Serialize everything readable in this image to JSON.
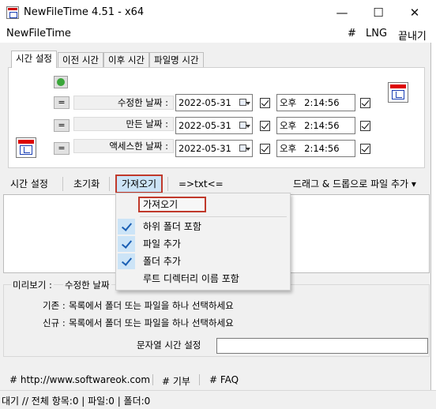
{
  "window": {
    "title": "NewFileTime 4.51 - x64",
    "minimize_glyph": "—",
    "maximize_glyph": "☐",
    "close_glyph": "✕"
  },
  "menu": {
    "app_name": "NewFileTime",
    "hash": "#",
    "lng": "LNG",
    "exit": "끝내기"
  },
  "tabs": [
    {
      "label": "시간 설정",
      "active": true
    },
    {
      "label": "이전 시간",
      "active": false
    },
    {
      "label": "이후 시간",
      "active": false
    },
    {
      "label": "파일명 시간",
      "active": false
    }
  ],
  "rows": [
    {
      "eq": "=",
      "label": "수정한 날짜 :",
      "date": "2022-05-31",
      "ampm": "오후",
      "time": "2:14:56"
    },
    {
      "eq": "=",
      "label": "만든 날짜 :",
      "date": "2022-05-31",
      "ampm": "오후",
      "time": "2:14:56"
    },
    {
      "eq": "=",
      "label": "액세스한 날짜 :",
      "date": "2022-05-31",
      "ampm": "오후",
      "time": "2:14:56"
    }
  ],
  "toolbar": {
    "time_setting": "시간 설정",
    "reset": "초기화",
    "import": "가져오기",
    "txt": "=>txt<=",
    "drag_drop": "드래그 & 드롭으로 파일 추가 ▾"
  },
  "dropdown": {
    "header": "가져오기",
    "items": [
      {
        "label": "하위 폴더 포함",
        "checked": true
      },
      {
        "label": "파일 추가",
        "checked": true
      },
      {
        "label": "폴더 추가",
        "checked": true
      },
      {
        "label": "루트 디렉터리 이름 포함",
        "checked": false
      }
    ]
  },
  "preview": {
    "label": "미리보기 :",
    "value": "수정한 날짜",
    "base_label": "기존 :",
    "base_text": "목록에서 폴더 또는 파일을 하나 선택하세요",
    "new_label": "신규 :",
    "new_text": "목록에서 폴더 또는 파일을 하나 선택하세요",
    "string_time_label": "문자열 시간 설정",
    "string_time_value": ""
  },
  "links": {
    "website": "# http://www.softwareok.com",
    "donate": "# 기부",
    "faq": "# FAQ"
  },
  "status": {
    "text": "대기 // 전체 항목:0 | 파일:0 | 폴더:0"
  },
  "colors": {
    "highlight_border": "#c0392b",
    "selection": "#cce4f7",
    "check_blue": "#1a5fb4"
  }
}
